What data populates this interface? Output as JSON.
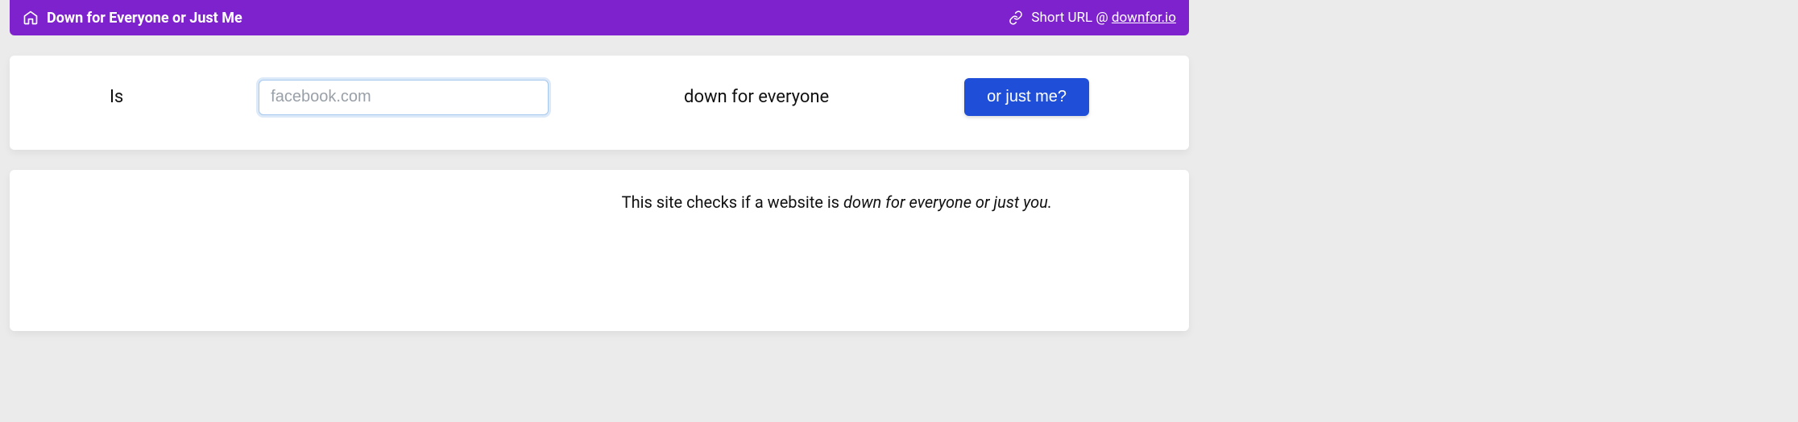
{
  "header": {
    "title": "Down for Everyone or Just Me",
    "short_url_prefix": "Short URL @ ",
    "short_url_link": "downfor.io"
  },
  "form": {
    "prefix_label": "Is",
    "input_value": "",
    "input_placeholder": "facebook.com",
    "middle_label": "down for everyone",
    "button_label": "or just me?"
  },
  "info": {
    "text_prefix": "This site checks if a website is ",
    "text_italic": "down for everyone or just you."
  }
}
